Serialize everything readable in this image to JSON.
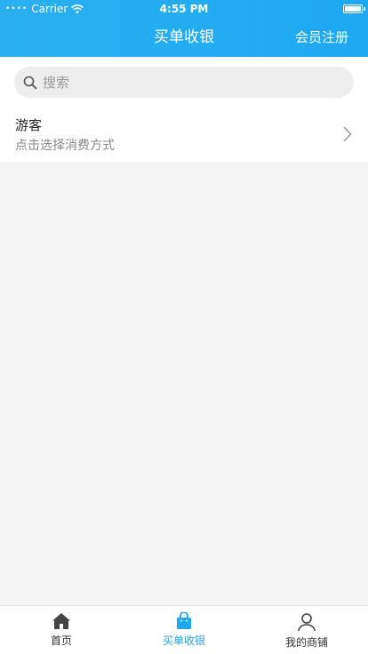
{
  "status_bar": {
    "carrier": "Carrier",
    "time": "4:55 PM"
  },
  "nav": {
    "title": "买单收银",
    "action": "会员注册"
  },
  "search": {
    "placeholder": "搜索",
    "value": ""
  },
  "customer": {
    "name": "游客",
    "subtitle": "点击选择消费方式"
  },
  "tabbar": {
    "active_color": "#1ea8f2",
    "items": [
      {
        "label": "首页",
        "icon": "home-icon"
      },
      {
        "label": "买单收银",
        "icon": "shopping-bag-icon"
      },
      {
        "label": "我的商铺",
        "icon": "user-icon"
      }
    ]
  },
  "colors": {
    "header": "#1ea8f2",
    "background": "#f5f5f5"
  }
}
